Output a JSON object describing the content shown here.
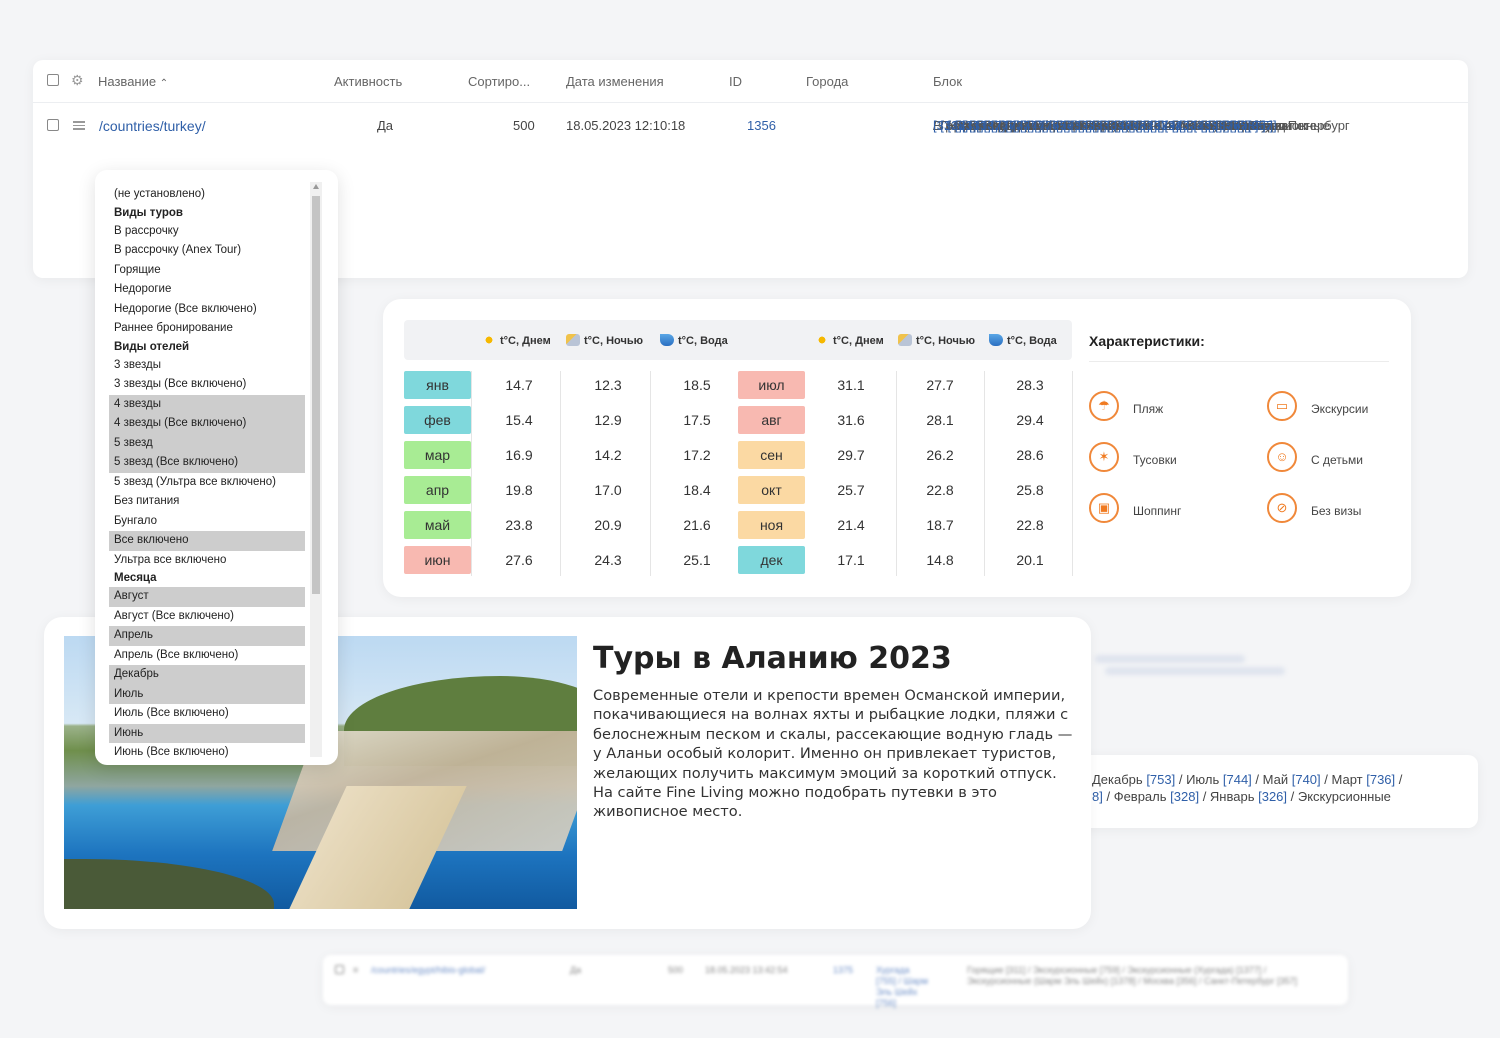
{
  "admin_table": {
    "columns": [
      "Название",
      "Активность",
      "Сортиро...",
      "Дата изменения",
      "ID",
      "Города",
      "Блок"
    ],
    "sort_indicator": "^",
    "row": {
      "name": "/countries/turkey/",
      "active": "Да",
      "sort": "500",
      "modified": "18.05.2023 12:10:18",
      "id": "1356",
      "cities": "",
      "blocks": [
        {
          "t": "В рассрочку",
          "n": "[314]"
        },
        {
          "t": "Горящие",
          "n": "[311]"
        },
        {
          "t": "Недорогие",
          "n": "[312]"
        },
        {
          "t": "Раннее бронирование",
          "n": "[814]"
        },
        {
          "t": "4 звезды",
          "n": "[319]"
        },
        {
          "t": "5 звезд",
          "n": "[316]"
        },
        {
          "t": "5 звезд (Все включено)",
          "n": "[317]"
        },
        {
          "t": "Все включено",
          "n": "[322]"
        },
        {
          "t": "Август",
          "n": "[746]"
        },
        {
          "t": "Апрель",
          "n": "[738]"
        },
        {
          "t": "Декабрь",
          "n": "[753]"
        },
        {
          "t": "Июль",
          "n": "[744]"
        },
        {
          "t": "Июнь",
          "n": "[742]"
        },
        {
          "t": "Май",
          "n": "[740]"
        },
        {
          "t": "Март",
          "n": "[736]"
        },
        {
          "t": "Ноябрь",
          "n": "[752]"
        },
        {
          "t": "Октябрь",
          "n": "[750]"
        },
        {
          "t": "Сентябрь",
          "n": "[748]"
        },
        {
          "t": "Сентябрь (Все включено)",
          "n": "[749]"
        },
        {
          "t": "Февраль",
          "n": "[328]"
        },
        {
          "t": "Февраль (Все включено)",
          "n": "[329]"
        },
        {
          "t": "Январь",
          "n": "[326]"
        },
        {
          "t": "Весна",
          "n": "[330]"
        },
        {
          "t": "Зима",
          "n": "[331]"
        },
        {
          "t": "Лето",
          "n": "[333]"
        },
        {
          "t": "Осень",
          "n": "[332]"
        },
        {
          "t": "10",
          "n": "[805]"
        },
        {
          "t": "14",
          "n": "[808]"
        },
        {
          "t": "7",
          "n": "[336]"
        },
        {
          "t": "8",
          "n": "[1372]"
        },
        {
          "t": "9",
          "n": "[339]"
        },
        {
          "t": "1",
          "n": "[343]"
        },
        {
          "t": "4",
          "n": "[342]"
        },
        {
          "t": "7",
          "n": "[1373]"
        },
        {
          "t": "Anex Tour",
          "n": "[347]"
        },
        {
          "t": "Biblio Globus",
          "n": "[349]"
        },
        {
          "t": "Coral Travel",
          "n": "[352]"
        },
        {
          "t": "FUN&SUN",
          "n": "[351]"
        },
        {
          "t": "Sunmar",
          "n": "[350]"
        },
        {
          "t": "Пегас Туристик",
          "n": "[348]"
        },
        {
          "t": "Новый год",
          "n": "[769]"
        },
        {
          "t": "С детьми",
          "n": "[754]"
        },
        {
          "t": "Экскурсионные",
          "n": "[759]"
        },
        {
          "t": "Москва",
          "n": "[356]"
        },
        {
          "t": "Санкт-Петербург",
          "n": "[357]"
        }
      ]
    }
  },
  "dropdown": {
    "options": [
      {
        "label": "(не установлено)",
        "group": false,
        "selected": false
      },
      {
        "label": "Виды туров",
        "group": true,
        "selected": false
      },
      {
        "label": "В рассрочку",
        "group": false,
        "selected": false
      },
      {
        "label": "В рассрочку (Anex Tour)",
        "group": false,
        "selected": false
      },
      {
        "label": "Горящие",
        "group": false,
        "selected": false
      },
      {
        "label": "Недорогие",
        "group": false,
        "selected": false
      },
      {
        "label": "Недорогие (Все включено)",
        "group": false,
        "selected": false
      },
      {
        "label": "Раннее бронирование",
        "group": false,
        "selected": false
      },
      {
        "label": "Виды отелей",
        "group": true,
        "selected": false
      },
      {
        "label": "3 звезды",
        "group": false,
        "selected": false
      },
      {
        "label": "3 звезды (Все включено)",
        "group": false,
        "selected": false
      },
      {
        "label": "4 звезды",
        "group": false,
        "selected": true
      },
      {
        "label": "4 звезды (Все включено)",
        "group": false,
        "selected": true
      },
      {
        "label": "5 звезд",
        "group": false,
        "selected": true
      },
      {
        "label": "5 звезд (Все включено)",
        "group": false,
        "selected": true
      },
      {
        "label": "5 звезд (Ультра все включено)",
        "group": false,
        "selected": false
      },
      {
        "label": "Без питания",
        "group": false,
        "selected": false
      },
      {
        "label": "Бунгало",
        "group": false,
        "selected": false
      },
      {
        "label": "Все включено",
        "group": false,
        "selected": true
      },
      {
        "label": "Ультра все включено",
        "group": false,
        "selected": false
      },
      {
        "label": "Месяца",
        "group": true,
        "selected": false
      },
      {
        "label": "Август",
        "group": false,
        "selected": true
      },
      {
        "label": "Август (Все включено)",
        "group": false,
        "selected": false
      },
      {
        "label": "Апрель",
        "group": false,
        "selected": true
      },
      {
        "label": "Апрель (Все включено)",
        "group": false,
        "selected": false
      },
      {
        "label": "Декабрь",
        "group": false,
        "selected": true
      },
      {
        "label": "Июль",
        "group": false,
        "selected": true
      },
      {
        "label": "Июль (Все включено)",
        "group": false,
        "selected": false
      },
      {
        "label": "Июнь",
        "group": false,
        "selected": true
      },
      {
        "label": "Июнь (Все включено)",
        "group": false,
        "selected": false
      }
    ]
  },
  "weather": {
    "headers": [
      "t°C, Днем",
      "t°C, Ночью",
      "t°C, Вода"
    ],
    "left": [
      {
        "month": "янв",
        "day": "14.7",
        "night": "12.3",
        "water": "18.5",
        "color": "#7fd8dc"
      },
      {
        "month": "фев",
        "day": "15.4",
        "night": "12.9",
        "water": "17.5",
        "color": "#7fd8dc"
      },
      {
        "month": "мар",
        "day": "16.9",
        "night": "14.2",
        "water": "17.2",
        "color": "#a8ec94"
      },
      {
        "month": "апр",
        "day": "19.8",
        "night": "17.0",
        "water": "18.4",
        "color": "#a8ec94"
      },
      {
        "month": "май",
        "day": "23.8",
        "night": "20.9",
        "water": "21.6",
        "color": "#a8ec94"
      },
      {
        "month": "июн",
        "day": "27.6",
        "night": "24.3",
        "water": "25.1",
        "color": "#f8b9b1"
      }
    ],
    "right": [
      {
        "month": "июл",
        "day": "31.1",
        "night": "27.7",
        "water": "28.3",
        "color": "#f8b9b1"
      },
      {
        "month": "авг",
        "day": "31.6",
        "night": "28.1",
        "water": "29.4",
        "color": "#f8b9b1"
      },
      {
        "month": "сен",
        "day": "29.7",
        "night": "26.2",
        "water": "28.6",
        "color": "#fbd9a3"
      },
      {
        "month": "окт",
        "day": "25.7",
        "night": "22.8",
        "water": "25.8",
        "color": "#fbd9a3"
      },
      {
        "month": "ноя",
        "day": "21.4",
        "night": "18.7",
        "water": "22.8",
        "color": "#fbd9a3"
      },
      {
        "month": "дек",
        "day": "17.1",
        "night": "14.8",
        "water": "20.1",
        "color": "#7fd8dc"
      }
    ],
    "characteristics_title": "Характеристики:",
    "characteristics": [
      {
        "label": "Пляж",
        "icon": "beach-umbrella-icon",
        "glyph": "☂"
      },
      {
        "label": "Экскурсии",
        "icon": "bus-icon",
        "glyph": "▭"
      },
      {
        "label": "Тусовки",
        "icon": "party-icon",
        "glyph": "✶"
      },
      {
        "label": "С детьми",
        "icon": "child-icon",
        "glyph": "☺"
      },
      {
        "label": "Шоппинг",
        "icon": "shopping-bag-icon",
        "glyph": "▣"
      },
      {
        "label": "Без визы",
        "icon": "no-visa-icon",
        "glyph": "⊘"
      }
    ]
  },
  "article": {
    "title": "Туры в Аланию 2023",
    "text": "Современные отели и крепости времен Османской империи, покачивающиеся на волнах яхты и рыбацкие лодки, пляжи с белоснежным песком и скалы, рассекающие водную гладь — у Аланьи особый колорит. Именно он привлекает туристов, желающих получить максимум эмоций за короткий отпуск. На сайте Fine Living можно подобрать путевки в это живописное место."
  },
  "right_fragment": {
    "line1": [
      {
        "t": "Декабрь",
        "n": "[753]"
      },
      {
        "t": "Июль",
        "n": "[744]"
      },
      {
        "t": "Май",
        "n": "[740]"
      },
      {
        "t": "Март",
        "n": "[736]"
      }
    ],
    "line2_prefix": "8]",
    "line2": [
      {
        "t": "Февраль",
        "n": "[328]"
      },
      {
        "t": "Январь",
        "n": "[326]"
      }
    ],
    "line2_suffix": "Экскурсионные"
  },
  "bottom_row": {
    "name": "/countries/egypt/hibis-global/",
    "active": "Да",
    "sort": "500",
    "modified": "18.05.2023 13:42:54",
    "id": "1375",
    "cities": "Хургада [755] / Шарм Эль Шейх [756]",
    "blocks": "Горящие [311] / Экскурсионные [759] / Экскурсионные (Хургада) [1377] / Экскурсионные (Шарм Эль Шейх) [1378] / Москва [356] / Санкт-Петербург [357]"
  }
}
